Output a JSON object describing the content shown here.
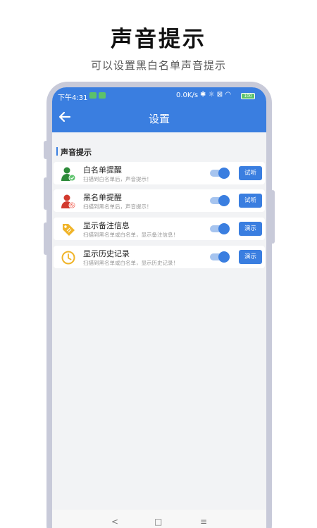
{
  "promo": {
    "title": "声音提示",
    "subtitle": "可以设置黑白名单声音提示"
  },
  "statusbar": {
    "time": "下午4:31",
    "network_speed": "0.0K/s",
    "battery": "100"
  },
  "appbar": {
    "title": "设置",
    "back_icon": "arrow-left-icon"
  },
  "section": {
    "header": "声音提示"
  },
  "settings": [
    {
      "title": "白名单提醒",
      "desc": "扫描到白名单后，声音提示！",
      "icon": "user-check-icon",
      "icon_color": "#2e8b3a",
      "enabled": true,
      "button": "试听"
    },
    {
      "title": "黑名单提醒",
      "desc": "扫描到黑名单后，声音提示！",
      "icon": "user-block-icon",
      "icon_color": "#d23a2e",
      "enabled": true,
      "button": "试听"
    },
    {
      "title": "显示备注信息",
      "desc": "扫描到黑名单或白名单，显示备注信息！",
      "icon": "tag-icon",
      "icon_color": "#f0b429",
      "enabled": true,
      "button": "演示"
    },
    {
      "title": "显示历史记录",
      "desc": "扫描到黑名单或白名单，显示历史记录！",
      "icon": "clock-icon",
      "icon_color": "#f0b429",
      "enabled": true,
      "button": "演示"
    }
  ],
  "navbar": {
    "back": "<",
    "home": "□",
    "menu": "≡"
  },
  "colors": {
    "primary": "#3a7ee0",
    "frame": "#c8cad9",
    "background": "#f2f3f5"
  }
}
